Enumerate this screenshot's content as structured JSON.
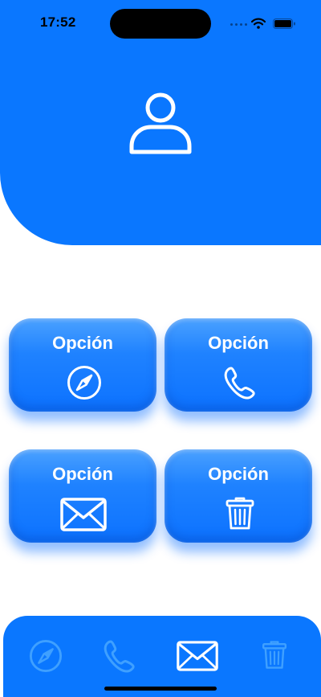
{
  "status_bar": {
    "time": "17:52"
  },
  "header": {
    "avatar_icon": "person-icon",
    "color": "#0a77ff"
  },
  "options": [
    {
      "label": "Opción",
      "icon": "compass-icon"
    },
    {
      "label": "Opción",
      "icon": "phone-icon"
    },
    {
      "label": "Opción",
      "icon": "envelope-icon"
    },
    {
      "label": "Opción",
      "icon": "trash-icon"
    }
  ],
  "tab_bar": {
    "tabs": [
      {
        "icon": "compass-icon",
        "selected": false
      },
      {
        "icon": "phone-icon",
        "selected": false
      },
      {
        "icon": "envelope-icon",
        "selected": true
      },
      {
        "icon": "trash-icon",
        "selected": false
      }
    ],
    "selected_color": "#ffffff",
    "unselected_color": "#3fa0ff"
  }
}
